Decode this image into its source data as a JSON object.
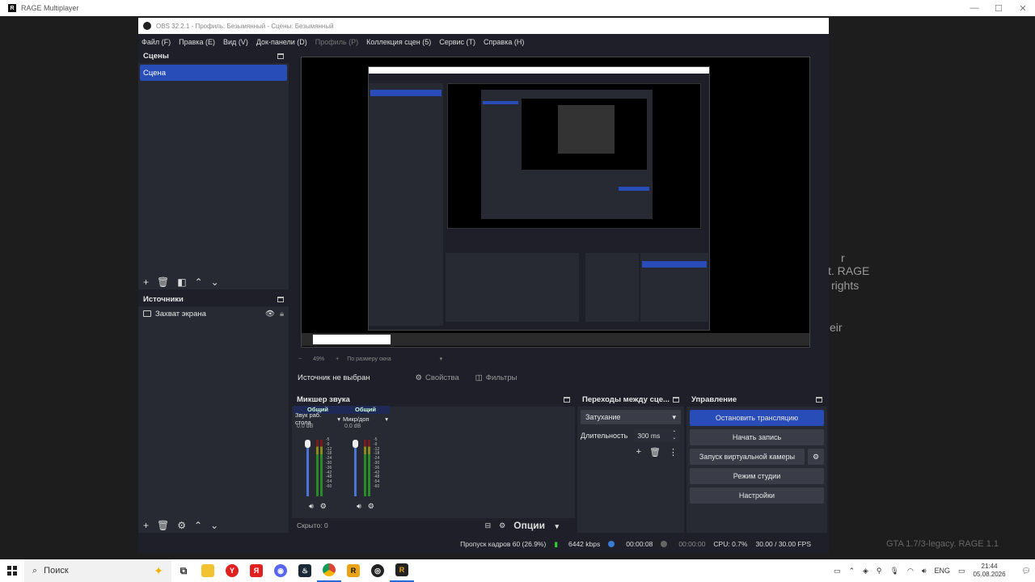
{
  "host": {
    "title": "RAGE Multiplayer",
    "ghost_text": [
      "r",
      "t. RAGE",
      "rights",
      "eir"
    ],
    "watermark": "GTA 1.7/3-legacy. RAGE 1.1"
  },
  "obs": {
    "title": "OBS 32.2.1 - Профиль: Безымянный - Сцены: Безымянный",
    "menu": [
      {
        "label": "Файл (F)",
        "enabled": true
      },
      {
        "label": "Правка (E)",
        "enabled": true
      },
      {
        "label": "Вид (V)",
        "enabled": true
      },
      {
        "label": "Док-панели (D)",
        "enabled": true
      },
      {
        "label": "Профиль (P)",
        "enabled": false
      },
      {
        "label": "Коллекция сцен (5)",
        "enabled": true
      },
      {
        "label": "Сервис (T)",
        "enabled": true
      },
      {
        "label": "Справка (H)",
        "enabled": true
      }
    ],
    "scenes": {
      "title": "Сцены",
      "items": [
        "Сцена"
      ]
    },
    "sources": {
      "title": "Источники",
      "items": [
        "Захват экрана"
      ]
    },
    "zoom": {
      "level": "49%",
      "fit": "По размеру окна"
    },
    "context": {
      "no_source": "Источник не выбран",
      "properties": "Свойства",
      "filters": "Фильтры"
    },
    "mixer": {
      "title": "Микшер звука",
      "channels": [
        {
          "header": "Общий",
          "name": "Звук раб. стола",
          "db": "0.0 dB"
        },
        {
          "header": "Общий",
          "name": "Микр/доп",
          "db": "0.0 dB"
        }
      ],
      "scale": [
        "-5",
        "-9",
        "-12",
        "-18",
        "-24",
        "-30",
        "-36",
        "-42",
        "-48",
        "-54",
        "-60"
      ],
      "hidden": "Скрыто: 0",
      "options": "Опции"
    },
    "transitions": {
      "title": "Переходы между сце...",
      "selected": "Затухание",
      "duration_label": "Длительность",
      "duration_value": "300 ms"
    },
    "controls": {
      "title": "Управление",
      "stop_stream": "Остановить трансляцию",
      "start_record": "Начать запись",
      "virtual_cam": "Запуск виртуальной камеры",
      "studio_mode": "Режим студии",
      "settings": "Настройки"
    },
    "status": {
      "dropped": "Пропуск кадров 60 (26.9%)",
      "bitrate": "6442 kbps",
      "stream_time": "00:00:08",
      "rec_time": "00:00:00",
      "cpu": "CPU: 0.7%",
      "fps": "30.00 / 30.00 FPS"
    }
  },
  "taskbar": {
    "search_label": "Поиск",
    "lang": "ENG",
    "time": "21:44",
    "date": "05.08.2026"
  }
}
